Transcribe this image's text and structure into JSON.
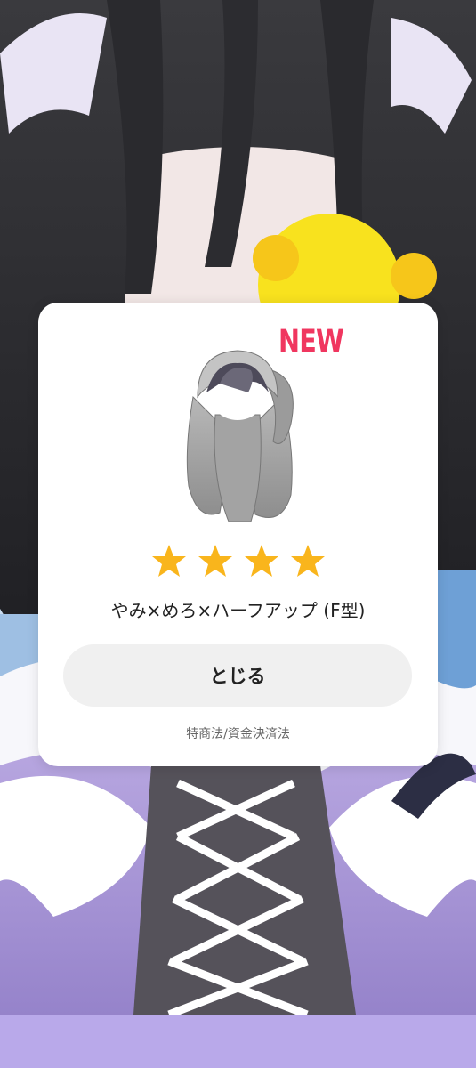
{
  "modal": {
    "new_badge": "NEW",
    "rating_stars": 4,
    "item_name": "やみ×めろ×ハーフアップ (F型)",
    "close_label": "とじる",
    "legal_link": "特商法/資金決済法"
  },
  "colors": {
    "new_badge": "#f0365f",
    "star": "#f9b51c",
    "button_bg": "#f0f0f0",
    "modal_bg": "#ffffff"
  },
  "icons": {
    "star": "star-icon",
    "item": "hair-item-icon"
  }
}
